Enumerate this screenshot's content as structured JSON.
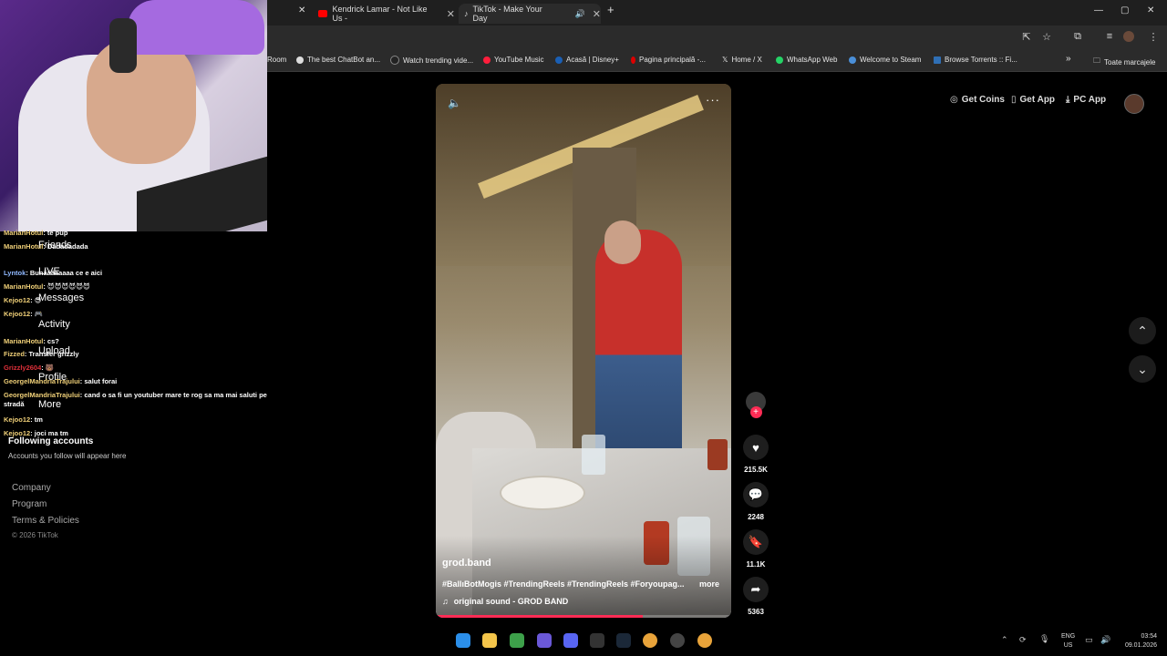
{
  "browser": {
    "tabs": [
      {
        "label": "Kendrick Lamar - Not Like Us -",
        "icon": "youtube-icon"
      },
      {
        "label": "TikTok - Make Your Day",
        "icon": "tiktok-icon",
        "active": true
      }
    ],
    "bookmarks": [
      {
        "label": "Room",
        "icon": ""
      },
      {
        "label": "The best ChatBot an...",
        "icon": "chatgpt-icon"
      },
      {
        "label": "Watch trending vide...",
        "icon": "tiktok-icon"
      },
      {
        "label": "YouTube Music",
        "icon": "youtube-music-icon"
      },
      {
        "label": "Acasă | Disney+",
        "icon": "disney-icon"
      },
      {
        "label": "Pagina principală -...",
        "icon": "opera-icon"
      },
      {
        "label": "Home / X",
        "icon": "x-icon"
      },
      {
        "label": "WhatsApp Web",
        "icon": "whatsapp-icon"
      },
      {
        "label": "Welcome to Steam",
        "icon": "steam-icon"
      },
      {
        "label": "Browse Torrents :: Fi...",
        "icon": "fl-icon"
      }
    ],
    "all_bookmarks": "Toate marcajele"
  },
  "chat": [
    {
      "user": "MarianHotul",
      "msg": ": te pup",
      "color": "#f0d078"
    },
    {
      "user": "MarianHotul",
      "msg": ": Dadadadada",
      "color": "#f0d078"
    },
    {
      "user": "Lyntok",
      "msg": ": Bunăăăăaaaa ce e aici",
      "color": "#8fb8ff"
    },
    {
      "user": "MarianHotul",
      "msg": ": 😈😈😈😈😈😈",
      "color": "#f0d078"
    },
    {
      "user": "Kejoo12",
      "msg": ": 😎",
      "color": "#f0d078"
    },
    {
      "user": "Kejoo12",
      "msg": ": 🎮",
      "color": "#f0d078"
    },
    {
      "user": "MarianHotul",
      "msg": ": cs?",
      "color": "#f0d078"
    },
    {
      "user": "Fizzed",
      "msg": ": Transfer grizzly",
      "color": "#f0d078"
    },
    {
      "user": "Grizzly2604",
      "msg": ": 🐻",
      "color": "#e0303a"
    },
    {
      "user": "GeorgelMandriaTrajului",
      "msg": ": salut forai",
      "color": "#f0d078"
    },
    {
      "user": "GeorgelMandriaTrajului",
      "msg": ": cand o sa fi un youtuber mare te rog sa ma mai saluti pe stradă",
      "color": "#f0d078"
    },
    {
      "user": "Kejoo12",
      "msg": ": tm",
      "color": "#f0d078"
    },
    {
      "user": "Kejoo12",
      "msg": ": joci ma tm",
      "color": "#f0d078"
    }
  ],
  "sidebar": {
    "nav": [
      "Friends",
      "LIVE",
      "Messages",
      "Activity",
      "Upload",
      "Profile",
      "More"
    ],
    "following_title": "Following accounts",
    "following_empty": "Accounts you follow will appear here",
    "footer": [
      "Company",
      "Program",
      "Terms & Policies"
    ],
    "copyright": "© 2026 TikTok"
  },
  "header": {
    "get_coins": "Get Coins",
    "get_app": "Get App",
    "pc_app": "PC App"
  },
  "video": {
    "author": "grod.band",
    "caption": "#BallıBotMogis #TrendingReels #TrendingReels #Foryoupag...",
    "more": "more",
    "sound": "original sound - GROD BAND",
    "progress": 0.7
  },
  "actions": {
    "likes": "215.5K",
    "comments": "2248",
    "saves": "11.1K",
    "shares": "5363"
  },
  "taskbar": {
    "lang_top": "ENG",
    "lang_bottom": "US",
    "time": "03:54",
    "date": "09.01.2026"
  },
  "colors": {
    "accent": "#fe2c55",
    "background": "#000000"
  }
}
